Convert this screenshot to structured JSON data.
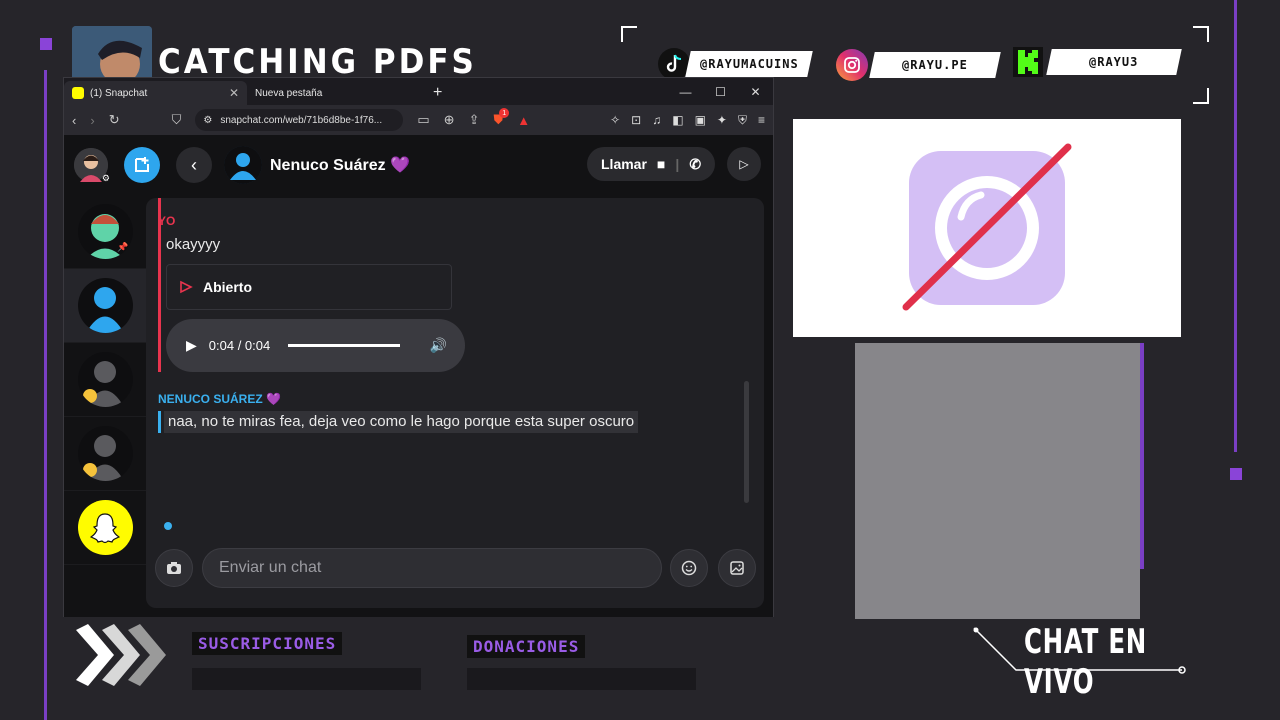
{
  "overlay": {
    "title": "CATCHING PDFS",
    "socials": [
      {
        "icon": "tiktok-icon",
        "handle": "@RAYUMACUINS"
      },
      {
        "icon": "instagram-icon",
        "handle": "@RAYU.PE"
      },
      {
        "icon": "kick-icon",
        "handle": "@RAYU3"
      }
    ],
    "subscriptions_label": "SUSCRIPCIONES",
    "donations_label": "DONACIONES",
    "chat_live_label": "CHAT EN VIVO",
    "accent_color": "#8a44d8"
  },
  "browser": {
    "tabs": [
      {
        "title": "(1) Snapchat",
        "active": true
      },
      {
        "title": "Nueva pestaña",
        "active": false
      }
    ],
    "url": "snapchat.com/web/71b6d8be-1f76...",
    "shield_badge": "1"
  },
  "snapchat": {
    "contact_name": "Nenuco Suárez 💜",
    "call_label": "Llamar",
    "messages": [
      {
        "sender": "YO",
        "text": "okayyyy"
      },
      {
        "sender": "NENUCO SUÁREZ 💜",
        "text": "naa, no te miras fea, deja veo como le hago porque esta super oscuro"
      }
    ],
    "opened_label": "Abierto",
    "audio_time": "0:04 / 0:04",
    "audio_progress": 1.0,
    "composer_placeholder": "Enviar un chat",
    "colors": {
      "me": "#e8344e",
      "friend": "#3ab0ef",
      "brand": "#fffc00"
    }
  }
}
